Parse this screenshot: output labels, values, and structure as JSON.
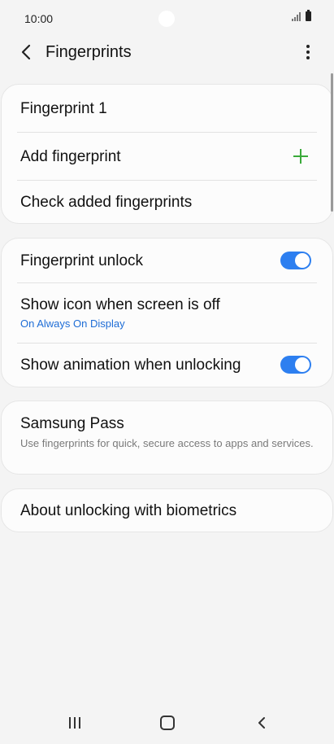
{
  "status_bar": {
    "time": "10:00"
  },
  "app_bar": {
    "title": "Fingerprints"
  },
  "card1": {
    "fingerprint_1": "Fingerprint 1",
    "add_fingerprint": "Add fingerprint",
    "check_added": "Check added fingerprints"
  },
  "card2": {
    "fingerprint_unlock": {
      "label": "Fingerprint unlock",
      "enabled": true
    },
    "show_icon": {
      "label": "Show icon when screen is off",
      "sub": "On Always On Display"
    },
    "show_animation": {
      "label": "Show animation when unlocking",
      "enabled": true
    }
  },
  "card3": {
    "samsung_pass": "Samsung Pass",
    "samsung_pass_desc": "Use fingerprints for quick, secure access to apps and services."
  },
  "card4": {
    "about": "About unlocking with biometrics"
  },
  "colors": {
    "accent": "#2d7ff0",
    "add_icon": "#3aaa3a",
    "link": "#1e6dd6"
  }
}
